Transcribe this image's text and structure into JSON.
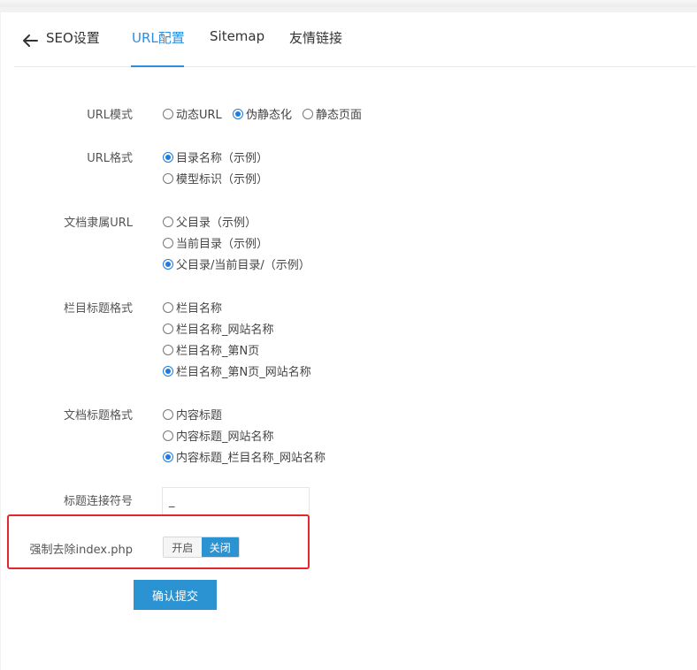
{
  "tabs": {
    "back_label": "SEO设置",
    "items": [
      "URL配置",
      "Sitemap",
      "友情链接"
    ]
  },
  "url_mode": {
    "label": "URL模式",
    "options": [
      "动态URL",
      "伪静态化",
      "静态页面"
    ],
    "selected": 1
  },
  "url_format": {
    "label": "URL格式",
    "options": [
      "目录名称（示例）",
      "模型标识（示例）"
    ],
    "selected": 0
  },
  "doc_url": {
    "label": "文档隶属URL",
    "options": [
      "父目录（示例）",
      "当前目录（示例）",
      "父目录/当前目录/（示例）"
    ],
    "selected": 2
  },
  "column_title": {
    "label": "栏目标题格式",
    "options": [
      "栏目名称",
      "栏目名称_网站名称",
      "栏目名称_第N页",
      "栏目名称_第N页_网站名称"
    ],
    "selected": 3
  },
  "doc_title": {
    "label": "文档标题格式",
    "options": [
      "内容标题",
      "内容标题_网站名称",
      "内容标题_栏目名称_网站名称"
    ],
    "selected": 2
  },
  "separator": {
    "label": "标题连接符号",
    "value": "_"
  },
  "force_index": {
    "label": "强制去除index.php",
    "on_label": "开启",
    "off_label": "关闭",
    "selected": "关闭"
  },
  "submit_label": "确认提交",
  "colors": {
    "accent": "#2c93d2",
    "tab_active": "#2b8ee0",
    "highlight": "#e5262a"
  }
}
